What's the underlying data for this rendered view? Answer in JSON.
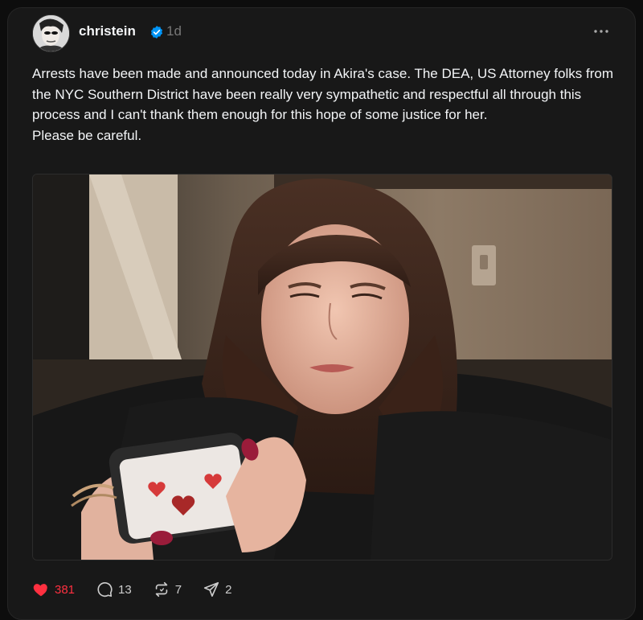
{
  "post": {
    "author": "christein",
    "verified": true,
    "time": "1d",
    "text": [
      "Arrests have been made and announced today in Akira's case. The DEA, US Attorney folks from the NYC Southern District have been really very sympathetic and respectful all through this process and I can't thank them enough for this hope of some justice for her.",
      "Please be careful."
    ]
  },
  "actions": {
    "likes": "381",
    "comments": "13",
    "reposts": "7",
    "shares": "2"
  },
  "colors": {
    "like_active": "#ff3040",
    "verified_badge": "#0095f6",
    "background": "#181818"
  },
  "icons": [
    "more-icon",
    "verified-icon",
    "heart-icon",
    "comment-icon",
    "repost-icon",
    "share-icon"
  ]
}
